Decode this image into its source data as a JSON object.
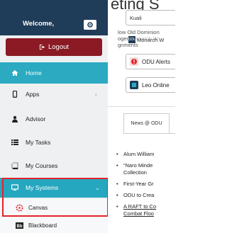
{
  "sidebar": {
    "welcome": "Welcome,",
    "logout": "Logout",
    "items": [
      {
        "label": "Home",
        "icon": "home-icon"
      },
      {
        "label": "Apps",
        "icon": "tablet-icon",
        "chevron": "‹"
      },
      {
        "label": "Advisor",
        "icon": "user-icon"
      },
      {
        "label": "My Tasks",
        "icon": "tasks-icon"
      },
      {
        "label": "My Courses",
        "icon": "book-icon"
      },
      {
        "label": "My Systems",
        "icon": "monitor-icon",
        "chevron": "⌄"
      }
    ],
    "subitems": [
      {
        "label": "Canvas",
        "icon": "canvas-icon"
      },
      {
        "label": "Blackboard",
        "icon": "blackboard-icon"
      }
    ]
  },
  "main": {
    "heading": "eting S",
    "search_value": "Kuali",
    "overlap_line1": "low Old Dominion",
    "overlap_line2": "ogeo  Monarch W",
    "overlap_line3": "gnments",
    "monarch_label": "Monarch W",
    "tiles": [
      {
        "label": "ODU Alerts",
        "icon": "alert-icon"
      },
      {
        "label": "Leo Online",
        "icon": "leo-icon"
      }
    ],
    "news_tab": "News @ ODU",
    "news": [
      {
        "line1": "Alum William",
        "line2": ""
      },
      {
        "line1": "“Naro Minde",
        "line2": "Collection"
      },
      {
        "line1": "First-Year Gr",
        "line2": ""
      },
      {
        "line1": "ODU to Crea",
        "line2": ""
      },
      {
        "line1": "A RAFT to Co",
        "line2": "Combat Floo"
      }
    ]
  },
  "colors": {
    "sidebar_header": "#1f3c58",
    "logout": "#8b1a25",
    "active_nav": "#2baac2",
    "highlight": "#e3242b"
  }
}
